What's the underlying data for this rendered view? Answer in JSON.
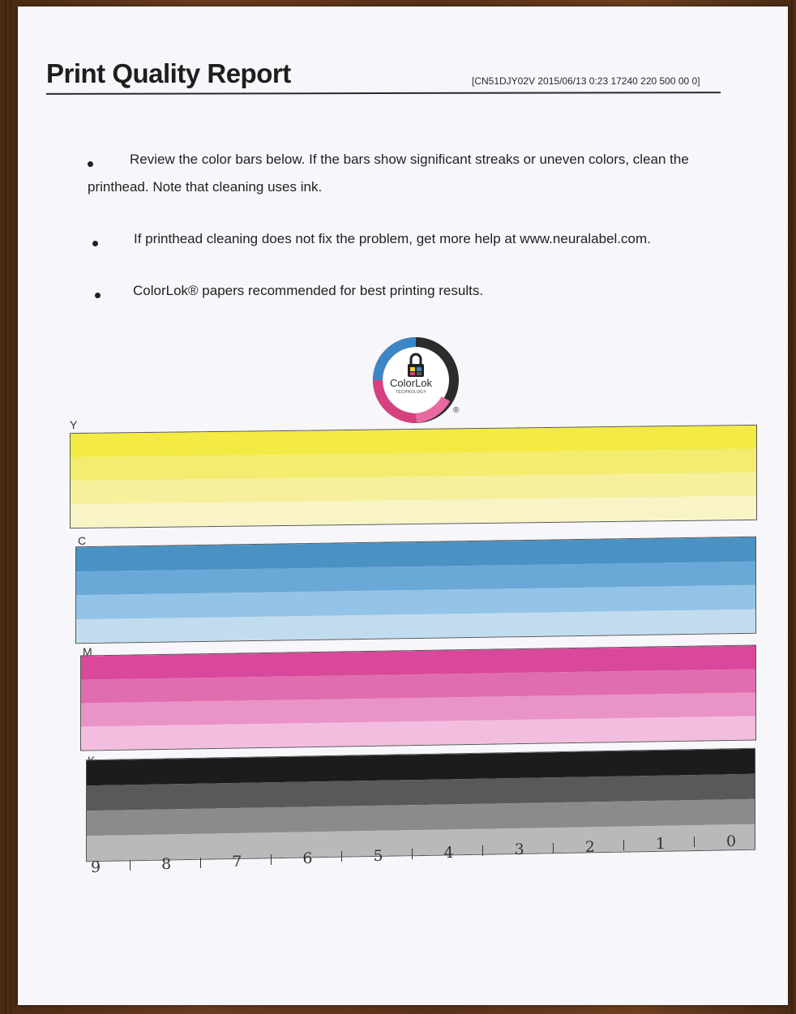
{
  "report": {
    "title": "Print Quality Report",
    "stamp": "[CN51DJY02V 2015/06/13  0:23 17240 220 500 00 0]"
  },
  "bullets": [
    "Review the color bars below. If the bars show significant streaks or uneven colors, clean the",
    "printhead. Note that cleaning uses ink.",
    "If printhead cleaning does not fix the problem, get more help at www.neuralabel.com.",
    "ColorLok® papers recommended for best printing results."
  ],
  "logo": {
    "name": "ColorLok",
    "sub": "TECHNOLOGY",
    "reg": "®"
  },
  "color_bars": [
    {
      "label": "Y",
      "bands": [
        "#f3ea44",
        "#f4ec6e",
        "#f6f09c",
        "#f8f4c6"
      ]
    },
    {
      "label": "C",
      "bands": [
        "#4a92c4",
        "#6aa8d7",
        "#93c3e6",
        "#c2dcef"
      ]
    },
    {
      "label": "M",
      "bands": [
        "#d9489a",
        "#e06daf",
        "#e993c7",
        "#f3bde0"
      ]
    },
    {
      "label": "K",
      "bands": [
        "#1c1c1c",
        "#595959",
        "#8b8b8b",
        "#b9b9b9"
      ]
    }
  ],
  "scale": {
    "numbers": [
      "9",
      "8",
      "7",
      "6",
      "5",
      "4",
      "3",
      "2",
      "1",
      "0"
    ]
  }
}
